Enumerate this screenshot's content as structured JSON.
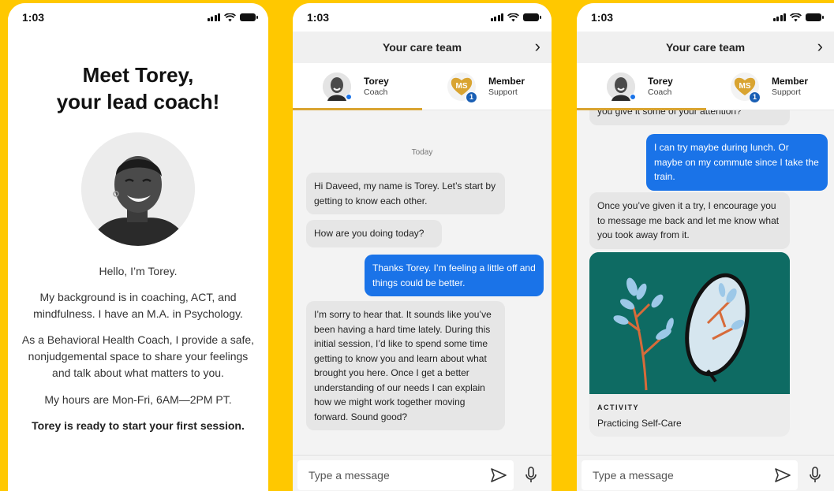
{
  "status": {
    "time": "1:03"
  },
  "intro": {
    "title_line1": "Meet Torey,",
    "title_line2": "your lead coach!",
    "hello": "Hello, I’m Torey.",
    "background": "My background is in coaching, ACT, and mindfulness. I have an M.A. in Psychology.",
    "role": "As a Behavioral Health Coach, I provide a safe, nonjudgemental space to share your feelings and talk about what matters to you.",
    "hours": "My hours are Mon-Fri, 6AM—2PM PT.",
    "ready": "Torey is ready to start your first session."
  },
  "chat_header": {
    "title": "Your care team"
  },
  "team": [
    {
      "name": "Torey",
      "role": "Coach"
    },
    {
      "name": "Member",
      "role": "Support",
      "initials": "MS",
      "badge": "1"
    }
  ],
  "chat1": {
    "date_label": "Today",
    "messages": [
      "Hi Daveed, my name is Torey. Let’s start by getting to know each other.",
      "How are you doing today?",
      "Thanks Torey. I’m feeling a little off and things could be better.",
      "I’m sorry to hear that. It sounds like you’ve been having a hard time lately. During this initial session, I’d like to spend some time getting to know you and learn about what brought you here. Once I get a better understanding of our needs I can explain how we might work together moving forward. Sound good?"
    ]
  },
  "chat2": {
    "messages": [
      "you give it some of your attention?",
      "I can try maybe during lunch. Or maybe on my commute since I take the train.",
      "Once you’ve given it a try, I encourage you to message me back and let me know what you took away from it."
    ],
    "activity": {
      "kicker": "ACTIVITY",
      "title": "Practicing Self-Care"
    }
  },
  "composer": {
    "placeholder": "Type a message"
  },
  "colors": {
    "accent_blue": "#1A73E8",
    "brand_yellow": "#FFC800",
    "gold": "#D9A431",
    "teal": "#0E6B63"
  }
}
